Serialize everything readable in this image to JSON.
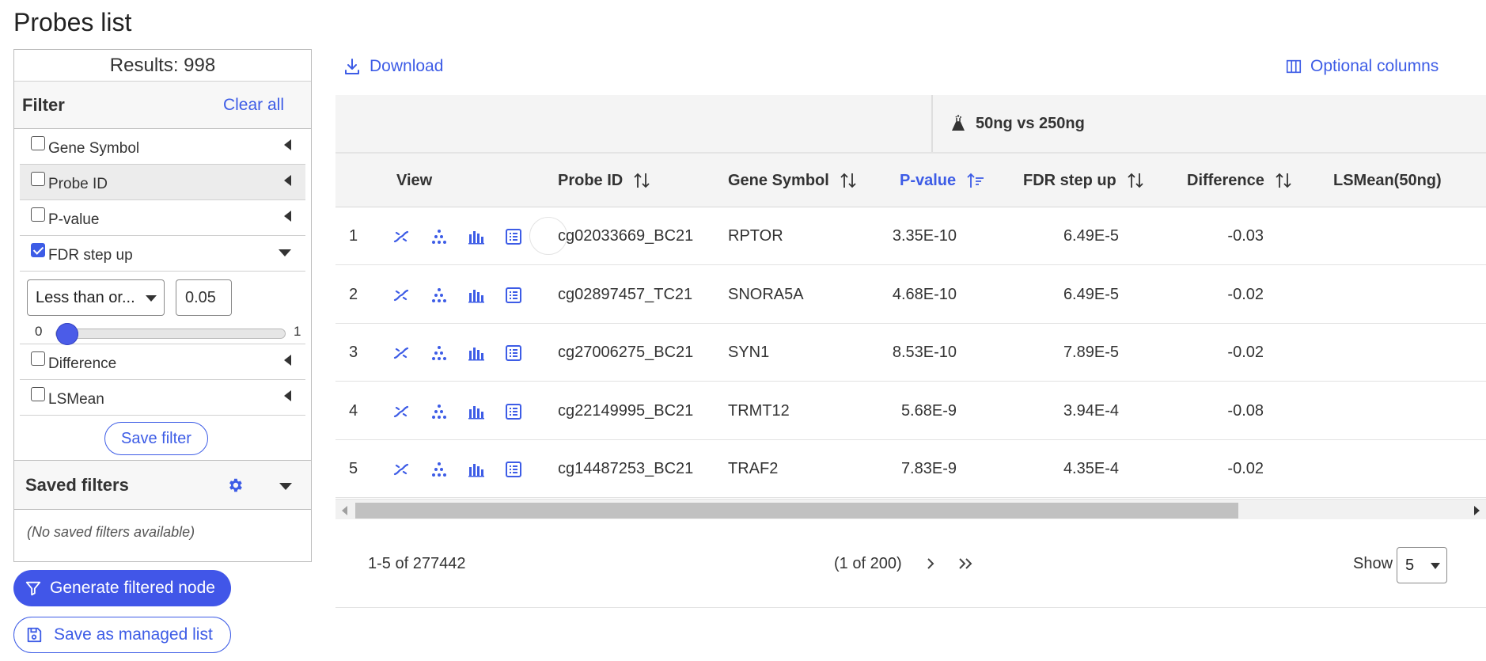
{
  "page": {
    "title": "Probes list"
  },
  "filter_panel": {
    "results_text": "Results: 998",
    "filter_title": "Filter",
    "clear_all_label": "Clear all",
    "items": [
      {
        "label": "Gene Symbol",
        "checked": false
      },
      {
        "label": "Probe ID",
        "checked": false
      },
      {
        "label": "P-value",
        "checked": false
      },
      {
        "label": "FDR step up",
        "checked": true
      },
      {
        "label": "Difference",
        "checked": false
      },
      {
        "label": "LSMean",
        "checked": false
      }
    ],
    "fdr": {
      "operator": "Less than or...",
      "value": "0.05",
      "slider_min": "0",
      "slider_max": "1",
      "slider_level": 0.05
    },
    "save_filter_label": "Save filter",
    "saved_filters_title": "Saved filters",
    "no_saved_text": "(No saved filters available)"
  },
  "actions": {
    "generate_label": "Generate filtered node",
    "save_list_label": "Save as managed list"
  },
  "toolbar": {
    "download_label": "Download",
    "optional_columns_label": "Optional columns"
  },
  "table": {
    "group_header": "50ng vs 250ng",
    "headers": {
      "view": "View",
      "probe_id": "Probe ID",
      "gene_symbol": "Gene Symbol",
      "p_value": "P-value",
      "fdr": "FDR step up",
      "difference": "Difference",
      "lsmean": "LSMean(50ng)"
    },
    "sorted_column": "P-value",
    "rows": [
      {
        "index": "1",
        "probe_id": "cg02033669_BC21",
        "gene_symbol": "RPTOR",
        "p_value": "3.35E-10",
        "fdr": "6.49E-5",
        "difference": "-0.03"
      },
      {
        "index": "2",
        "probe_id": "cg02897457_TC21",
        "gene_symbol": "SNORA5A",
        "p_value": "4.68E-10",
        "fdr": "6.49E-5",
        "difference": "-0.02"
      },
      {
        "index": "3",
        "probe_id": "cg27006275_BC21",
        "gene_symbol": "SYN1",
        "p_value": "8.53E-10",
        "fdr": "7.89E-5",
        "difference": "-0.02"
      },
      {
        "index": "4",
        "probe_id": "cg22149995_BC21",
        "gene_symbol": "TRMT12",
        "p_value": "5.68E-9",
        "fdr": "3.94E-4",
        "difference": "-0.08"
      },
      {
        "index": "5",
        "probe_id": "cg14487253_BC21",
        "gene_symbol": "TRAF2",
        "p_value": "7.83E-9",
        "fdr": "4.35E-4",
        "difference": "-0.02"
      }
    ],
    "view_icons": [
      "volcano-icon",
      "scatter-icon",
      "bar-chart-icon",
      "details-icon"
    ]
  },
  "pagination": {
    "range_text": "1-5 of 277442",
    "page_text": "(1 of 200)",
    "show_label": "Show",
    "page_size": "5"
  },
  "colors": {
    "accent": "#3d5ce6",
    "primary_button": "#4156e8"
  }
}
